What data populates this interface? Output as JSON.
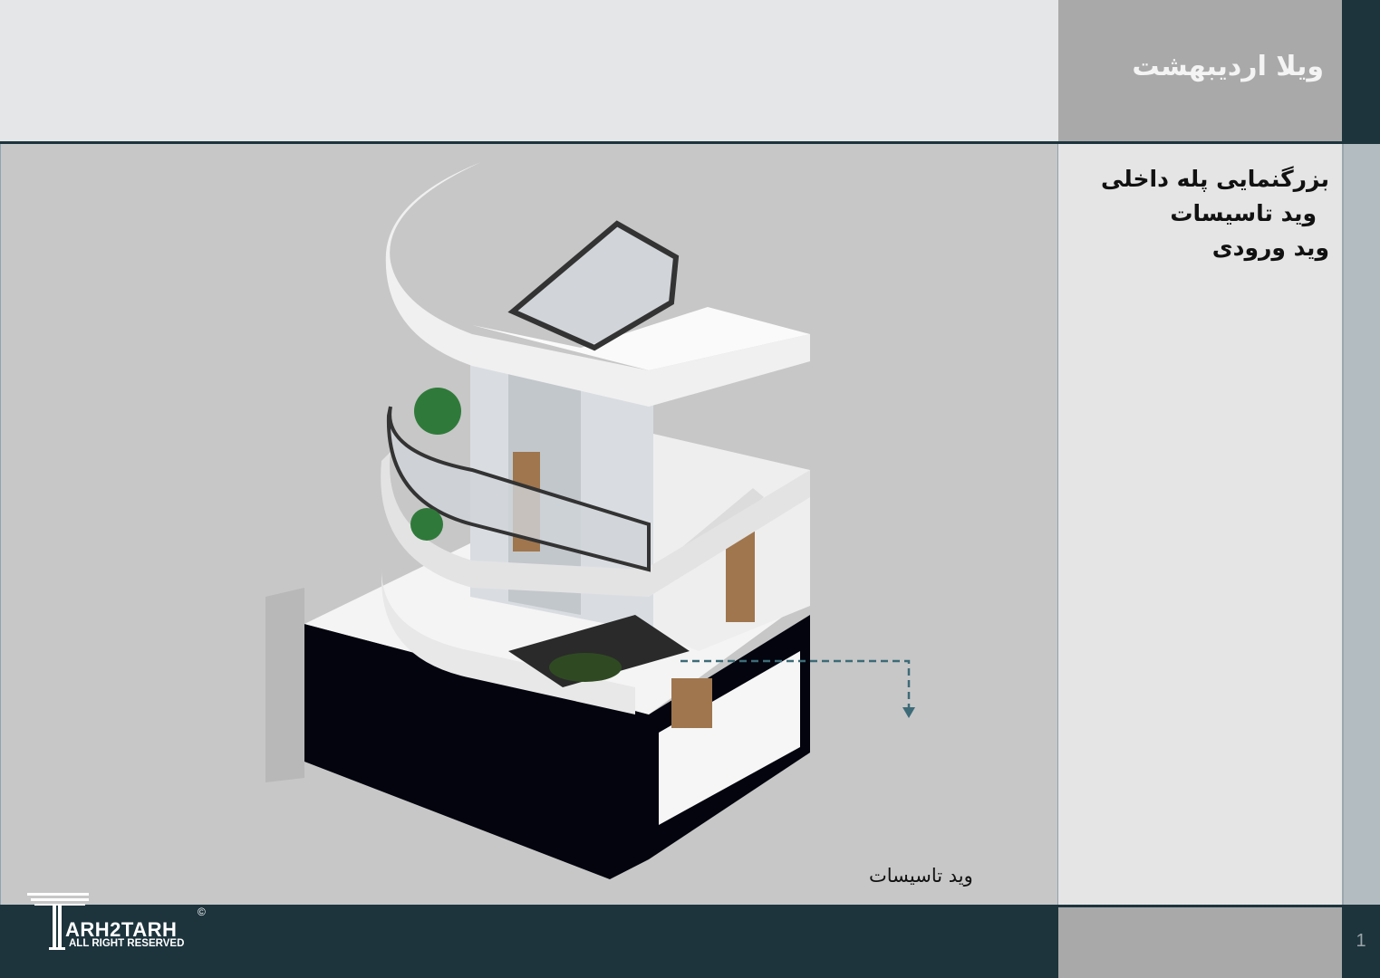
{
  "header": {
    "title": "ویلا اردیبهشت"
  },
  "side_panel": {
    "lines": [
      "بزرگنمایی پله داخلی",
      "وید تاسیسات",
      "وید ورودی"
    ]
  },
  "drawing": {
    "callout_label": "وید تاسیسات"
  },
  "footer": {
    "logo_main": "ARH2TARH",
    "logo_sub": "ALL RIGHT RESERVED",
    "logo_copyright": "©",
    "page_number": "1"
  },
  "colors": {
    "dark_teal": "#1d343d",
    "panel_gray": "#a9a9a9",
    "background_gray": "#c7c7c7",
    "callout_line": "#3d6b78"
  }
}
